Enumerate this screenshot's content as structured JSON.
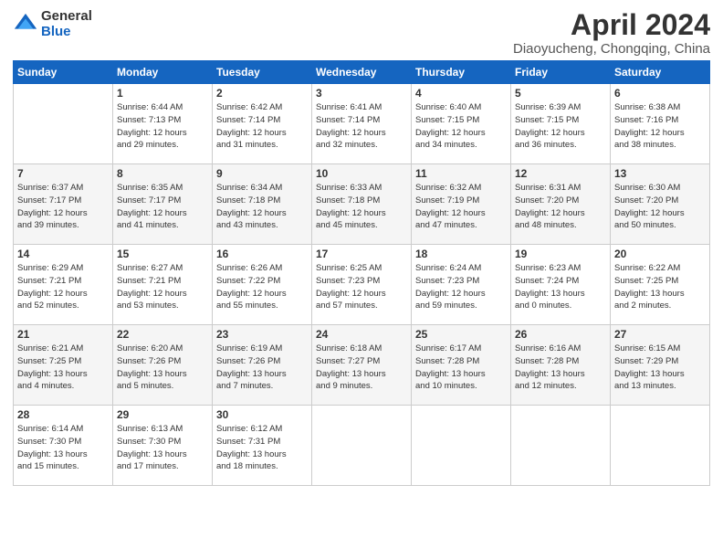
{
  "logo": {
    "general": "General",
    "blue": "Blue"
  },
  "title": "April 2024",
  "subtitle": "Diaoyucheng, Chongqing, China",
  "weekdays": [
    "Sunday",
    "Monday",
    "Tuesday",
    "Wednesday",
    "Thursday",
    "Friday",
    "Saturday"
  ],
  "weeks": [
    [
      {
        "day": "",
        "info": ""
      },
      {
        "day": "1",
        "info": "Sunrise: 6:44 AM\nSunset: 7:13 PM\nDaylight: 12 hours\nand 29 minutes."
      },
      {
        "day": "2",
        "info": "Sunrise: 6:42 AM\nSunset: 7:14 PM\nDaylight: 12 hours\nand 31 minutes."
      },
      {
        "day": "3",
        "info": "Sunrise: 6:41 AM\nSunset: 7:14 PM\nDaylight: 12 hours\nand 32 minutes."
      },
      {
        "day": "4",
        "info": "Sunrise: 6:40 AM\nSunset: 7:15 PM\nDaylight: 12 hours\nand 34 minutes."
      },
      {
        "day": "5",
        "info": "Sunrise: 6:39 AM\nSunset: 7:15 PM\nDaylight: 12 hours\nand 36 minutes."
      },
      {
        "day": "6",
        "info": "Sunrise: 6:38 AM\nSunset: 7:16 PM\nDaylight: 12 hours\nand 38 minutes."
      }
    ],
    [
      {
        "day": "7",
        "info": "Sunrise: 6:37 AM\nSunset: 7:17 PM\nDaylight: 12 hours\nand 39 minutes."
      },
      {
        "day": "8",
        "info": "Sunrise: 6:35 AM\nSunset: 7:17 PM\nDaylight: 12 hours\nand 41 minutes."
      },
      {
        "day": "9",
        "info": "Sunrise: 6:34 AM\nSunset: 7:18 PM\nDaylight: 12 hours\nand 43 minutes."
      },
      {
        "day": "10",
        "info": "Sunrise: 6:33 AM\nSunset: 7:18 PM\nDaylight: 12 hours\nand 45 minutes."
      },
      {
        "day": "11",
        "info": "Sunrise: 6:32 AM\nSunset: 7:19 PM\nDaylight: 12 hours\nand 47 minutes."
      },
      {
        "day": "12",
        "info": "Sunrise: 6:31 AM\nSunset: 7:20 PM\nDaylight: 12 hours\nand 48 minutes."
      },
      {
        "day": "13",
        "info": "Sunrise: 6:30 AM\nSunset: 7:20 PM\nDaylight: 12 hours\nand 50 minutes."
      }
    ],
    [
      {
        "day": "14",
        "info": "Sunrise: 6:29 AM\nSunset: 7:21 PM\nDaylight: 12 hours\nand 52 minutes."
      },
      {
        "day": "15",
        "info": "Sunrise: 6:27 AM\nSunset: 7:21 PM\nDaylight: 12 hours\nand 53 minutes."
      },
      {
        "day": "16",
        "info": "Sunrise: 6:26 AM\nSunset: 7:22 PM\nDaylight: 12 hours\nand 55 minutes."
      },
      {
        "day": "17",
        "info": "Sunrise: 6:25 AM\nSunset: 7:23 PM\nDaylight: 12 hours\nand 57 minutes."
      },
      {
        "day": "18",
        "info": "Sunrise: 6:24 AM\nSunset: 7:23 PM\nDaylight: 12 hours\nand 59 minutes."
      },
      {
        "day": "19",
        "info": "Sunrise: 6:23 AM\nSunset: 7:24 PM\nDaylight: 13 hours\nand 0 minutes."
      },
      {
        "day": "20",
        "info": "Sunrise: 6:22 AM\nSunset: 7:25 PM\nDaylight: 13 hours\nand 2 minutes."
      }
    ],
    [
      {
        "day": "21",
        "info": "Sunrise: 6:21 AM\nSunset: 7:25 PM\nDaylight: 13 hours\nand 4 minutes."
      },
      {
        "day": "22",
        "info": "Sunrise: 6:20 AM\nSunset: 7:26 PM\nDaylight: 13 hours\nand 5 minutes."
      },
      {
        "day": "23",
        "info": "Sunrise: 6:19 AM\nSunset: 7:26 PM\nDaylight: 13 hours\nand 7 minutes."
      },
      {
        "day": "24",
        "info": "Sunrise: 6:18 AM\nSunset: 7:27 PM\nDaylight: 13 hours\nand 9 minutes."
      },
      {
        "day": "25",
        "info": "Sunrise: 6:17 AM\nSunset: 7:28 PM\nDaylight: 13 hours\nand 10 minutes."
      },
      {
        "day": "26",
        "info": "Sunrise: 6:16 AM\nSunset: 7:28 PM\nDaylight: 13 hours\nand 12 minutes."
      },
      {
        "day": "27",
        "info": "Sunrise: 6:15 AM\nSunset: 7:29 PM\nDaylight: 13 hours\nand 13 minutes."
      }
    ],
    [
      {
        "day": "28",
        "info": "Sunrise: 6:14 AM\nSunset: 7:30 PM\nDaylight: 13 hours\nand 15 minutes."
      },
      {
        "day": "29",
        "info": "Sunrise: 6:13 AM\nSunset: 7:30 PM\nDaylight: 13 hours\nand 17 minutes."
      },
      {
        "day": "30",
        "info": "Sunrise: 6:12 AM\nSunset: 7:31 PM\nDaylight: 13 hours\nand 18 minutes."
      },
      {
        "day": "",
        "info": ""
      },
      {
        "day": "",
        "info": ""
      },
      {
        "day": "",
        "info": ""
      },
      {
        "day": "",
        "info": ""
      }
    ]
  ]
}
